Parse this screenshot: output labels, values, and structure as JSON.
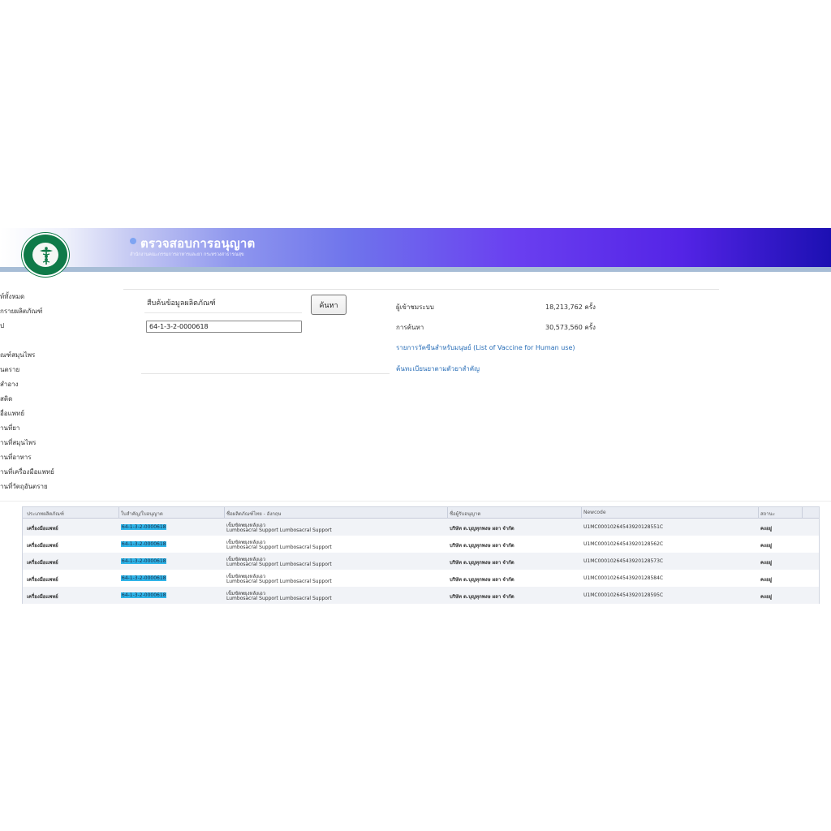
{
  "header": {
    "title": "ตรวจสอบการอนุญาต",
    "subtitle": "สำนักงานคณะกรรมการอาหารและยา กระทรวงสาธารณสุข"
  },
  "sidemenu": {
    "items": [
      "ท์ทั้งหมด",
      "กรายผลิตภัณฑ์",
      "ป",
      "ณฑ์สมุนไพร",
      "นตราย",
      "สำอาง",
      "สติด",
      "อื่อแพทย์",
      "านที่ยา",
      "านที่สมุนไพร",
      "านที่อาหาร",
      "านที่เครื่องมือแพทย์",
      "านที่วัตถุอันตราย"
    ]
  },
  "search": {
    "label": "สืบค้นข้อมูลผลิตภัณฑ์",
    "value": "64-1-3-2-0000618",
    "button_label": "ค้นหา"
  },
  "stats": {
    "visitors_label": "ผู้เข้าชมระบบ",
    "visitors_value": "18,213,762 ครั้ง",
    "searches_label": "การค้นหา",
    "searches_value": "30,573,560 ครั้ง"
  },
  "links": {
    "vaccine": "รายการวัคซีนสำหรับมนุษย์ (List of Vaccine for Human use)",
    "drug_registration": "ค้นทะเบียนยาตามตัวยาสำคัญ"
  },
  "table": {
    "columns": [
      "ประเภทผลิตภัณฑ์",
      "ใบสำคัญ/ใบอนุญาต",
      "ชื่อผลิตภัณฑ์ไทย - อังกฤษ",
      "ชื่อผู้รับอนุญาต",
      "Newcode",
      "สถานะ"
    ],
    "rows": [
      {
        "type": "เครื่องมือแพทย์",
        "license": "64-1-3-2-0000618",
        "name_th": "เข็มขัดพยุงหลังเอว",
        "name_en": "Lumbosacral Support Lumbosacral Support",
        "licensee": "บริษัท ต.บุญทุกพงษ ผลา จำกัด",
        "newcode": "U1MC00010264543920128551C",
        "status": "คงอยู่"
      },
      {
        "type": "เครื่องมือแพทย์",
        "license": "64-1-3-2-0000618",
        "name_th": "เข็มขัดพยุงหลังเอว",
        "name_en": "Lumbosacral Support Lumbosacral Support",
        "licensee": "บริษัท ต.บุญทุกพงษ ผลา จำกัด",
        "newcode": "U1MC00010264543920128562C",
        "status": "คงอยู่"
      },
      {
        "type": "เครื่องมือแพทย์",
        "license": "64-1-3-2-0000618",
        "name_th": "เข็มขัดพยุงหลังเอว",
        "name_en": "Lumbosacral Support Lumbosacral Support",
        "licensee": "บริษัท ต.บุญทุกพงษ ผลา จำกัด",
        "newcode": "U1MC00010264543920128573C",
        "status": "คงอยู่"
      },
      {
        "type": "เครื่องมือแพทย์",
        "license": "64-1-3-2-0000618",
        "name_th": "เข็มขัดพยุงหลังเอว",
        "name_en": "Lumbosacral Support Lumbosacral Support",
        "licensee": "บริษัท ต.บุญทุกพงษ ผลา จำกัด",
        "newcode": "U1MC00010264543920128584C",
        "status": "คงอยู่"
      },
      {
        "type": "เครื่องมือแพทย์",
        "license": "64-1-3-2-0000618",
        "name_th": "เข็มขัดพยุงหลังเอว",
        "name_en": "Lumbosacral Support Lumbosacral Support",
        "licensee": "บริษัท ต.บุญทุกพงษ ผลา จำกัด",
        "newcode": "U1MC00010264543920128595C",
        "status": "คงอยู่"
      }
    ]
  },
  "icons": {
    "logo": "ministry-of-public-health-logo",
    "title_bullet": "dot-icon"
  },
  "colors": {
    "banner_end": "#1c10b2",
    "banner_mid": "#6a3ff0",
    "link": "#2a6fb8",
    "highlight": "#2fb4e8",
    "logo_green": "#0f7a48"
  }
}
